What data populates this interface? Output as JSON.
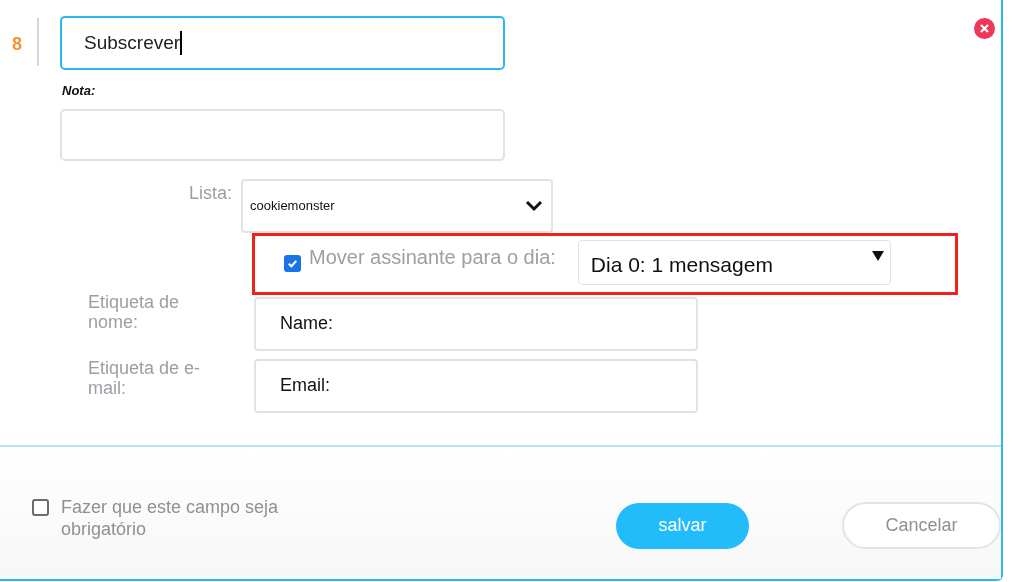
{
  "row_number": "8",
  "title_field": {
    "value": "Subscrever",
    "focused": true
  },
  "note": {
    "label": "Nota:"
  },
  "list": {
    "label": "Lista:",
    "value": "cookiemonster"
  },
  "move_day": {
    "checked": true,
    "highlighted": true,
    "label": "Mover assinante para o dia:",
    "value": "Dia 0: 1 mensagem"
  },
  "name_label": {
    "label": "Etiqueta de nome:",
    "value": "Name:"
  },
  "email_label": {
    "label": "Etiqueta de e-mail:",
    "value": "Email:"
  },
  "required": {
    "checked": false,
    "label": "Fazer que este campo seja obrigatório"
  },
  "buttons": [
    {
      "label": "salvar",
      "kind": "primary"
    },
    {
      "label": "Cancelar",
      "kind": "secondary"
    }
  ]
}
